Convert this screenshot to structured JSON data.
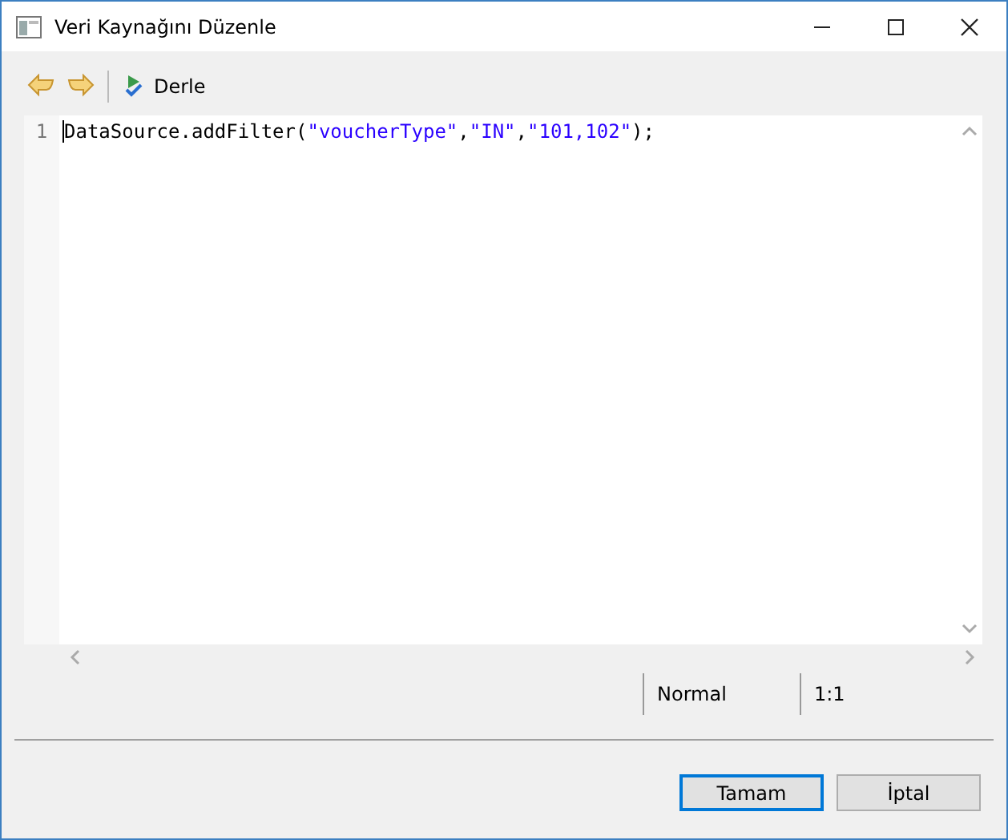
{
  "window": {
    "title": "Veri Kaynağını Düzenle"
  },
  "toolbar": {
    "compile_label": "Derle"
  },
  "editor": {
    "lines": [
      {
        "number": "1",
        "tokens": [
          {
            "text": "DataSource.addFilter(",
            "kind": "plain"
          },
          {
            "text": "\"voucherType\"",
            "kind": "string"
          },
          {
            "text": ",",
            "kind": "plain"
          },
          {
            "text": "\"IN\"",
            "kind": "string"
          },
          {
            "text": ",",
            "kind": "plain"
          },
          {
            "text": "\"101,102\"",
            "kind": "string"
          },
          {
            "text": ");",
            "kind": "plain"
          }
        ]
      }
    ]
  },
  "status_bar": {
    "mode": "Normal",
    "position": "1:1"
  },
  "buttons": [
    {
      "label": "Tamam",
      "default": true
    },
    {
      "label": "İptal",
      "default": false
    }
  ]
}
